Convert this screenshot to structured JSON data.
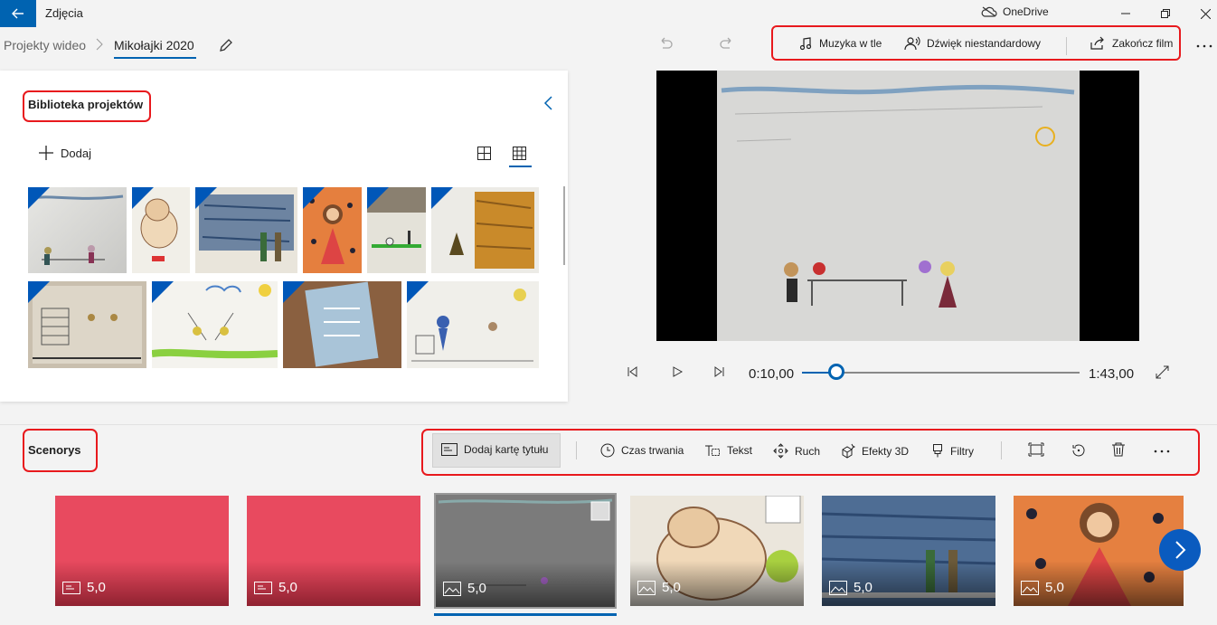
{
  "app": {
    "title": "Zdjęcia",
    "onedrive_label": "OneDrive"
  },
  "breadcrumb": {
    "parent": "Projekty wideo",
    "current": "Mikołajki 2020"
  },
  "toolbar": {
    "background_music": "Muzyka w tle",
    "custom_audio": "Dźwięk niestandardowy",
    "finish_video": "Zakończ film"
  },
  "library": {
    "title": "Biblioteka projektów",
    "add_label": "Dodaj"
  },
  "player": {
    "current_time": "0:10,00",
    "total_time": "1:43,00",
    "progress": 0.097
  },
  "storyboard": {
    "title": "Scenorys",
    "tools": {
      "title_card": "Dodaj kartę tytułu",
      "duration": "Czas trwania",
      "text": "Tekst",
      "motion": "Ruch",
      "effects_3d": "Efekty 3D",
      "filters": "Filtry"
    },
    "clips": [
      {
        "duration": "5,0",
        "kind": "title-card"
      },
      {
        "duration": "5,0",
        "kind": "title-card"
      },
      {
        "duration": "5,0",
        "kind": "image",
        "selected": true
      },
      {
        "duration": "5,0",
        "kind": "image"
      },
      {
        "duration": "5,0",
        "kind": "image"
      },
      {
        "duration": "5,0",
        "kind": "image"
      }
    ]
  },
  "colors": {
    "accent": "#0063b1",
    "title_card": "#e84a5f",
    "highlight": "#e8191d"
  }
}
